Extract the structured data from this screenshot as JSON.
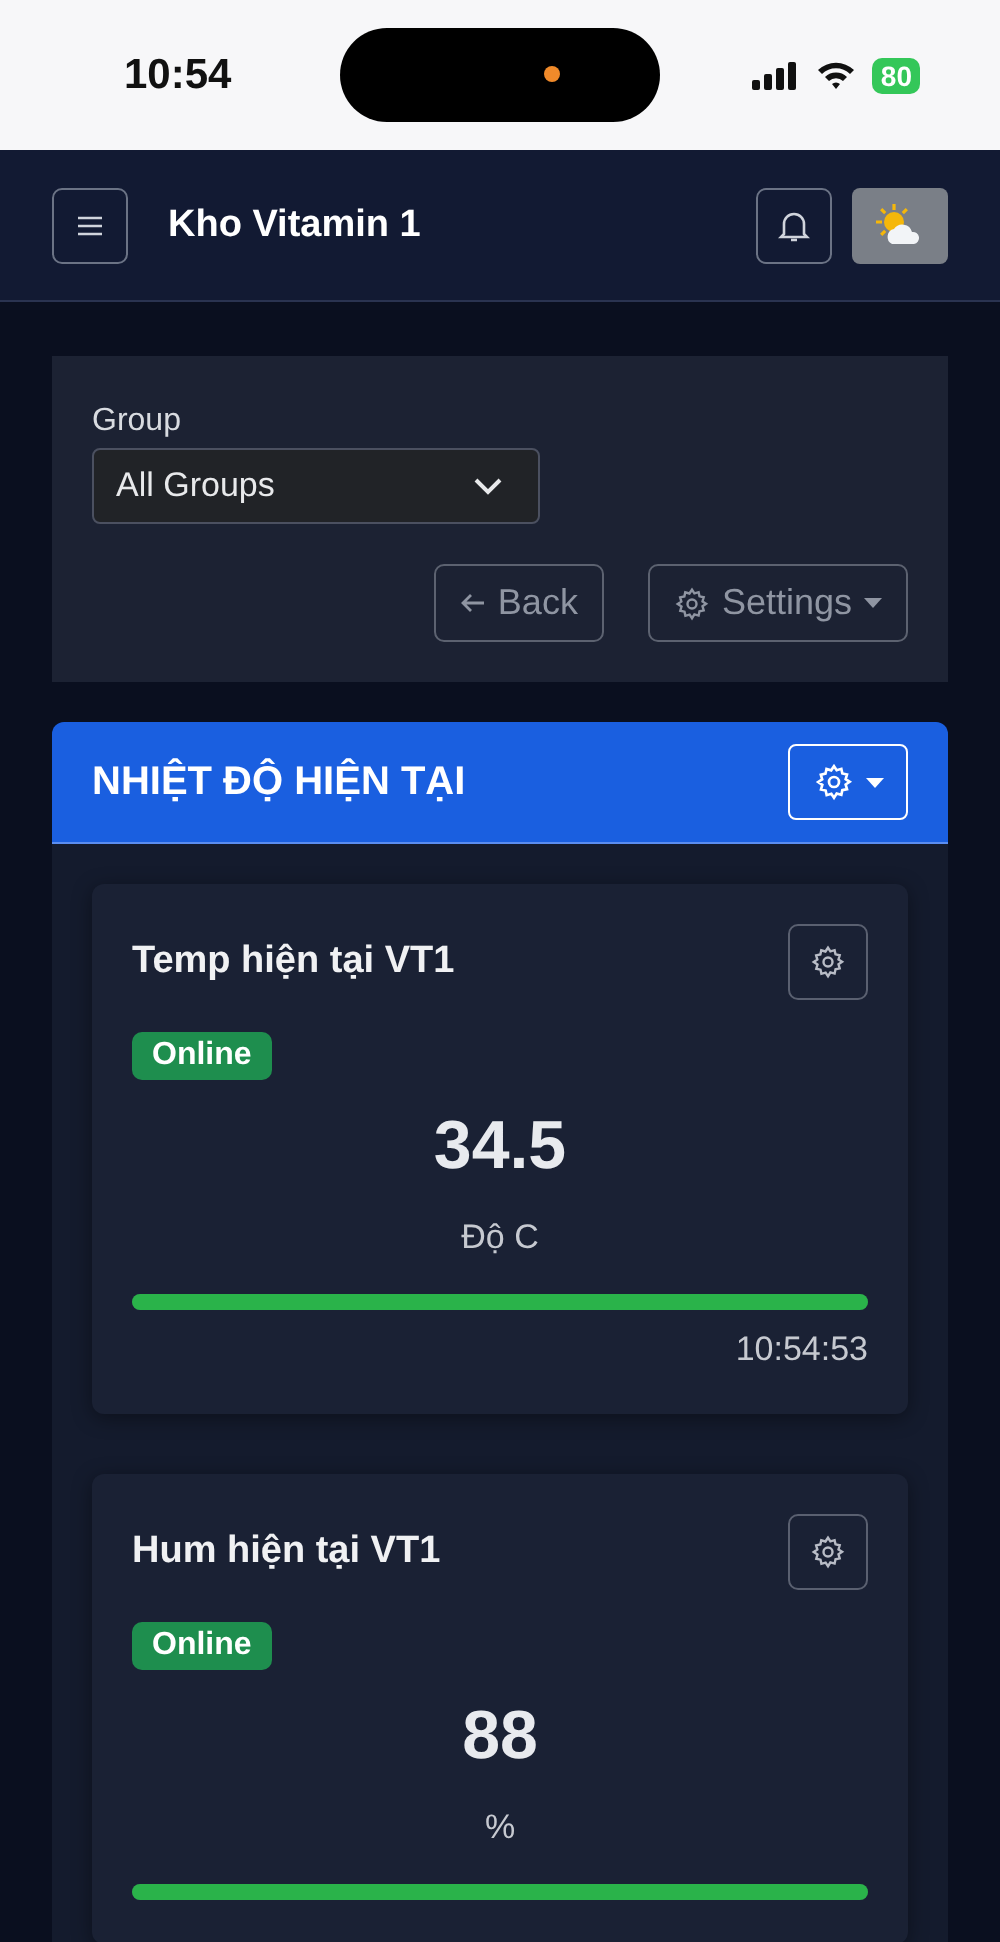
{
  "status_bar": {
    "time": "10:54",
    "battery": "80"
  },
  "header": {
    "title": "Kho Vitamin 1"
  },
  "filter": {
    "label": "Group",
    "value": "All Groups",
    "buttons": [
      {
        "kind": "back",
        "label": "Back"
      },
      {
        "kind": "settings",
        "label": "Settings"
      }
    ]
  },
  "section": {
    "title": "NHIỆT ĐỘ HIỆN TẠI"
  },
  "cards": [
    {
      "title": "Temp hiện tại VT1",
      "status": "Online",
      "value": "34.5",
      "unit": "Độ C",
      "level": 1,
      "time": "10:54:53"
    },
    {
      "title": "Hum hiện tại VT1",
      "status": "Online",
      "value": "88",
      "unit": "%",
      "level": 1
    }
  ]
}
